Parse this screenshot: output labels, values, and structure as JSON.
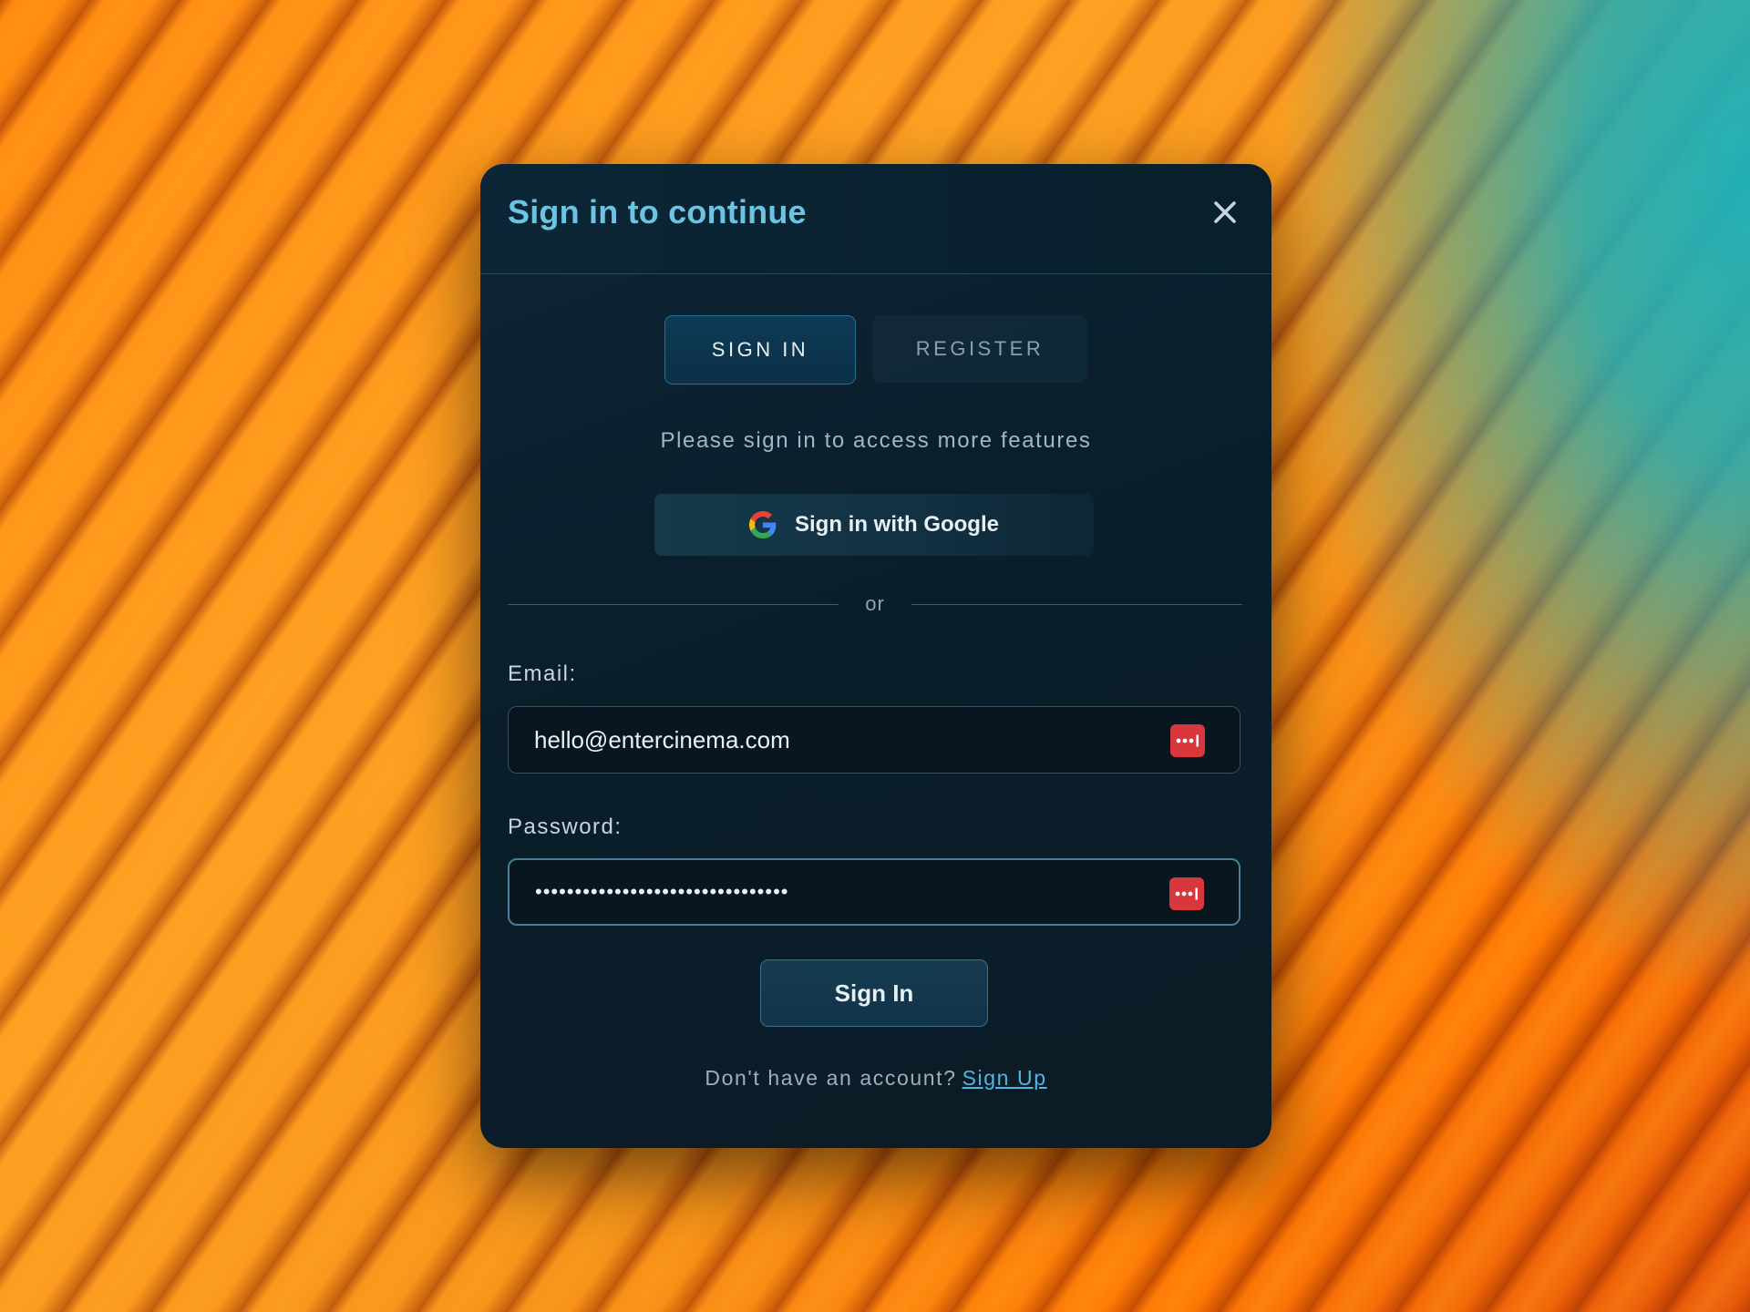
{
  "modal": {
    "title": "Sign in to continue",
    "close_icon": "close-icon"
  },
  "tabs": [
    {
      "label": "SIGN IN",
      "active": true
    },
    {
      "label": "REGISTER",
      "active": false
    }
  ],
  "subtitle": "Please sign in to access more features",
  "google_button": {
    "label": "Sign in with Google",
    "icon": "google-icon"
  },
  "divider_text": "or",
  "email": {
    "label": "Email:",
    "value": "hello@entercinema.com",
    "icon": "password-manager-icon"
  },
  "password": {
    "label": "Password:",
    "value": "••••••••••••••••••••••••••••••••",
    "icon": "password-manager-icon"
  },
  "submit_label": "Sign In",
  "footer": {
    "prompt": "Don't have an account?",
    "link": "Sign Up"
  },
  "colors": {
    "accent": "#6cc4e2",
    "link": "#4fb8e0",
    "modal_bg": "#0b1e2a",
    "password_manager": "#d8383b"
  }
}
